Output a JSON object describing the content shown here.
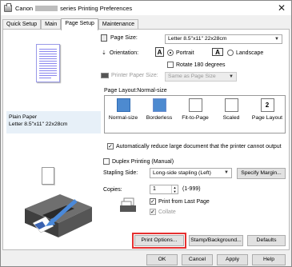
{
  "window": {
    "title_prefix": "Canon",
    "title_suffix": "series Printing Preferences",
    "close_glyph": "✕"
  },
  "tabs": [
    {
      "label": "Quick Setup"
    },
    {
      "label": "Main"
    },
    {
      "label": "Page Setup"
    },
    {
      "label": "Maintenance"
    }
  ],
  "left": {
    "paper_line1": "Plain Paper",
    "paper_line2": "Letter 8.5\"x11\" 22x28cm"
  },
  "page_size": {
    "label": "Page Size:",
    "value": "Letter 8.5\"x11\" 22x28cm"
  },
  "orientation": {
    "label": "Orientation:",
    "portrait": "Portrait",
    "landscape": "Landscape",
    "rotate": "Rotate 180 degrees"
  },
  "printer_paper_size": {
    "label": "Printer Paper Size:",
    "value": "Same as Page Size"
  },
  "page_layout": {
    "label": "Page Layout:Normal-size",
    "items": [
      {
        "label": "Normal-size"
      },
      {
        "label": "Borderless"
      },
      {
        "label": "Fit-to-Page"
      },
      {
        "label": "Scaled"
      },
      {
        "label": "Page Layout"
      }
    ]
  },
  "auto_reduce": {
    "label": "Automatically reduce large document that the printer cannot output"
  },
  "duplex": {
    "label": "Duplex Printing (Manual)"
  },
  "stapling": {
    "label": "Stapling Side:",
    "value": "Long-side stapling (Left)",
    "button": "Specify Margin..."
  },
  "copies": {
    "label": "Copies:",
    "value": "1",
    "range": "(1-999)",
    "print_last": "Print from Last Page",
    "collate": "Collate"
  },
  "buttons": {
    "print_options": "Print Options...",
    "stamp": "Stamp/Background...",
    "defaults": "Defaults"
  },
  "footer": {
    "ok": "OK",
    "cancel": "Cancel",
    "apply": "Apply",
    "help": "Help"
  },
  "colors": {
    "highlight": "#e53030",
    "selected_layout": "#4d8ad0"
  }
}
